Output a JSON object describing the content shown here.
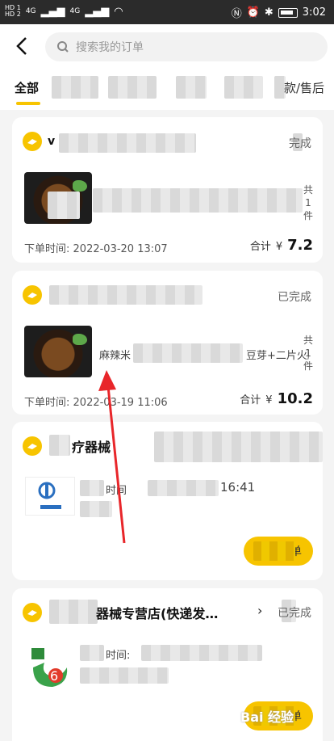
{
  "status_bar": {
    "time": "3:02",
    "left_labels": [
      "HD 1",
      "HD 2",
      "4G",
      "4G"
    ]
  },
  "search": {
    "placeholder": "搜索我的订单"
  },
  "tabs": [
    {
      "label": "全部"
    },
    {
      "label": "款/售后"
    }
  ],
  "orders": [
    {
      "shop_name": "v",
      "status": "完成",
      "item_title": "",
      "qty_label": "共1件",
      "order_time_label": "下单时间:",
      "order_time": "2022-03-20 13:07",
      "total_label": "合计",
      "currency": "¥",
      "amount": "7.2"
    },
    {
      "shop_name": "",
      "status": "已完成",
      "item_title": "麻辣米",
      "item_title_tail": "豆芽+二片火腿",
      "qty_label": "共1件",
      "order_time_label": "下单时间:",
      "order_time": "2022-03-19 11:06",
      "total_label": "合计",
      "currency": "¥",
      "amount": "10.2"
    },
    {
      "shop_name": "疗器械",
      "info_label": "时间",
      "info_time": "16:41",
      "button_label": "单"
    },
    {
      "shop_name": "器械专营店(快递发…",
      "status": "已完成",
      "info_label": "时间:",
      "button_label": "单"
    }
  ],
  "watermark": "Bai 经验",
  "colors": {
    "accent": "#f7c400",
    "arrow": "#e8262a"
  }
}
